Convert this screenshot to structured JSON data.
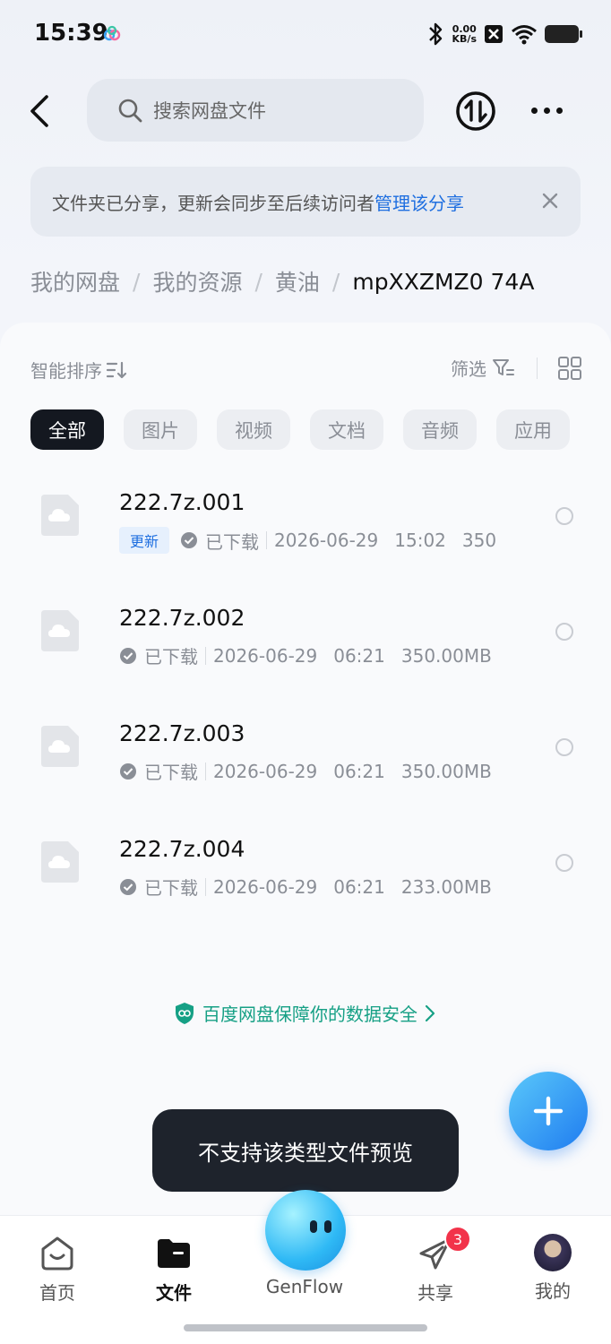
{
  "status_bar": {
    "time": "15:39",
    "net_speed_value": "0.00",
    "net_speed_unit": "KB/s"
  },
  "header": {
    "search_placeholder": "搜索网盘文件"
  },
  "share_banner": {
    "text": "文件夹已分享，更新会同步至后续访问者",
    "link": "管理该分享"
  },
  "breadcrumb": {
    "items": [
      "我的网盘",
      "我的资源",
      "黄油"
    ],
    "separator": "/",
    "current": "mpXXZMZ0 74A"
  },
  "toolbar": {
    "sort_label": "智能排序",
    "filter_label": "筛选"
  },
  "categories": [
    "全部",
    "图片",
    "视频",
    "文档",
    "音频",
    "应用"
  ],
  "files": [
    {
      "name": "222.7z.001",
      "badge": "更新",
      "status": "已下载",
      "date": "2026-06-29",
      "time": "15:02",
      "size": "350"
    },
    {
      "name": "222.7z.002",
      "badge": "",
      "status": "已下载",
      "date": "2026-06-29",
      "time": "06:21",
      "size": "350.00MB"
    },
    {
      "name": "222.7z.003",
      "badge": "",
      "status": "已下载",
      "date": "2026-06-29",
      "time": "06:21",
      "size": "350.00MB"
    },
    {
      "name": "222.7z.004",
      "badge": "",
      "status": "已下载",
      "date": "2026-06-29",
      "time": "06:21",
      "size": "233.00MB"
    }
  ],
  "security_notice": "百度网盘保障你的数据安全",
  "toast": "不支持该类型文件预览",
  "tabbar": {
    "home": "首页",
    "files": "文件",
    "genflow": "GenFlow",
    "share": "共享",
    "share_badge": "3",
    "mine": "我的"
  },
  "colors": {
    "accent": "#1f6fe0",
    "security_green": "#16a085",
    "badge_red": "#f2334a",
    "fab_gradient_start": "#5ac8fa",
    "fab_gradient_end": "#1f7cf0"
  }
}
